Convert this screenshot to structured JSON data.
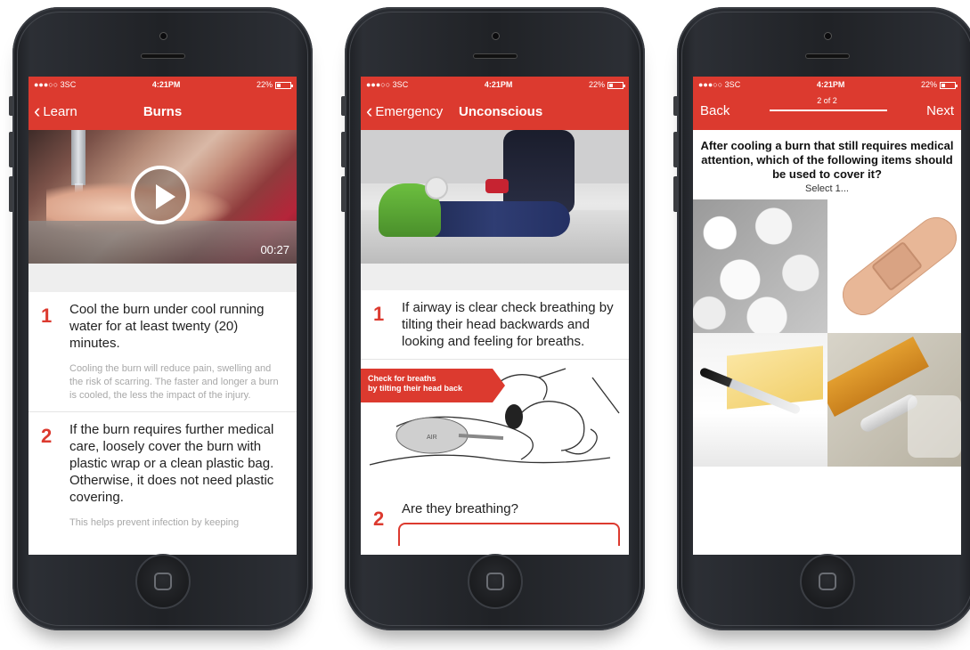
{
  "status_bar": {
    "carrier": "●●●○○ 3SC",
    "time": "4:21PM",
    "battery": "22%"
  },
  "screen1": {
    "back_label": "Learn",
    "title": "Burns",
    "video_duration": "00:27",
    "steps": [
      {
        "number": "1",
        "text": "Cool the burn under cool running water for at least twenty (20) minutes.",
        "note": "Cooling the burn will reduce pain, swelling and the risk of scarring. The faster and longer a burn is cooled, the less the impact of the injury."
      },
      {
        "number": "2",
        "text": "If the burn requires further medical care, loosely cover the burn with plastic wrap or a clean plastic bag. Otherwise, it does not need plastic covering.",
        "note": "This helps prevent infection by keeping"
      }
    ]
  },
  "screen2": {
    "back_label": "Emergency",
    "title": "Unconscious",
    "steps": [
      {
        "number": "1",
        "text": "If airway is clear check breathing by tilting their head backwards and looking and feeling for breaths."
      },
      {
        "number": "2",
        "text": "Are they breathing?"
      }
    ],
    "callout_line1": "Check for breaths",
    "callout_line2": "by tilting their head back",
    "diagram_label": "AIR"
  },
  "screen3": {
    "back_label": "Back",
    "next_label": "Next",
    "counter": "2 of 2",
    "progress_fraction": 1.0,
    "question": "After cooling a burn that still requires medical attention, which of the following items should be used to cover it?",
    "hint": "Select 1...",
    "options": [
      "cotton-balls",
      "adhesive-bandage",
      "butter",
      "plastic-wrap"
    ]
  },
  "colors": {
    "accent": "#dc3a2f"
  }
}
